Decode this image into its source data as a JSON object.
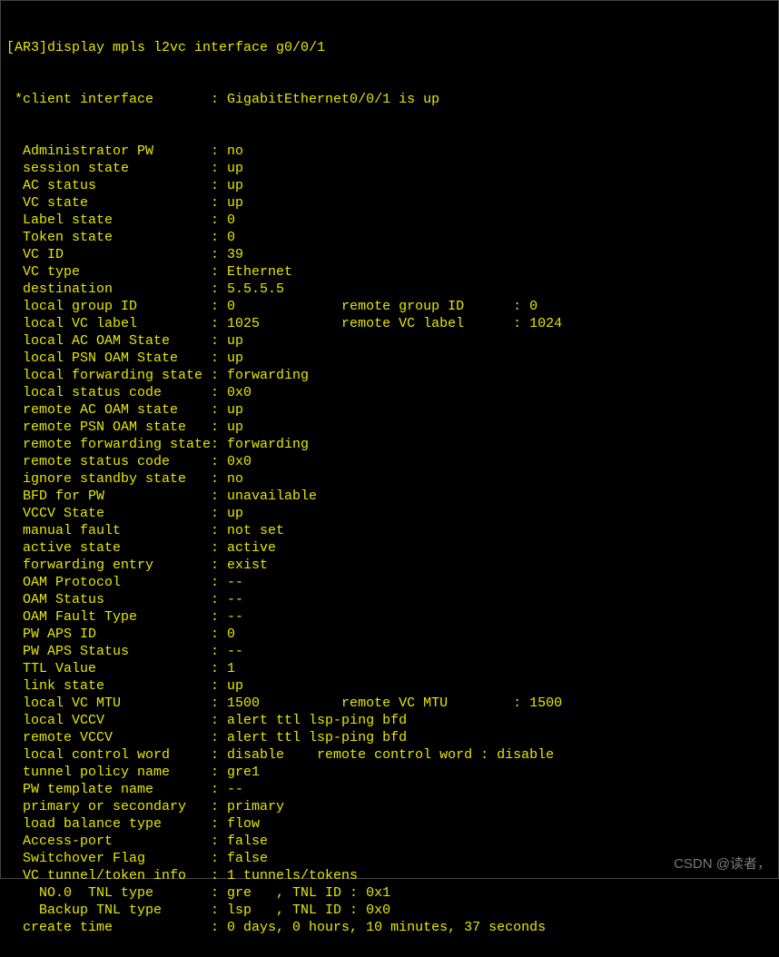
{
  "prompt_prefix": "[AR3]",
  "command": "display mpls l2vc interface g0/0/1",
  "client_interface_line": " *client interface       : GigabitEthernet0/0/1 is up",
  "rows": [
    {
      "label": "  Administrator PW",
      "value": "no"
    },
    {
      "label": "  session state",
      "value": "up"
    },
    {
      "label": "  AC status",
      "value": "up"
    },
    {
      "label": "  VC state",
      "value": "up"
    },
    {
      "label": "  Label state",
      "value": "0"
    },
    {
      "label": "  Token state",
      "value": "0"
    },
    {
      "label": "  VC ID",
      "value": "39"
    },
    {
      "label": "  VC type",
      "value": "Ethernet"
    },
    {
      "label": "  destination",
      "value": "5.5.5.5"
    },
    {
      "label": "  local group ID",
      "value": "0",
      "label2": "remote group ID",
      "value2": "0"
    },
    {
      "label": "  local VC label",
      "value": "1025",
      "label2": "remote VC label",
      "value2": "1024"
    },
    {
      "label": "  local AC OAM State",
      "value": "up"
    },
    {
      "label": "  local PSN OAM State",
      "value": "up"
    },
    {
      "label": "  local forwarding state",
      "value": "forwarding"
    },
    {
      "label": "  local status code",
      "value": "0x0"
    },
    {
      "label": "  remote AC OAM state",
      "value": "up"
    },
    {
      "label": "  remote PSN OAM state",
      "value": "up"
    },
    {
      "label": "  remote forwarding state",
      "value": "forwarding"
    },
    {
      "label": "  remote status code",
      "value": "0x0"
    },
    {
      "label": "  ignore standby state",
      "value": "no"
    },
    {
      "label": "  BFD for PW",
      "value": "unavailable"
    },
    {
      "label": "  VCCV State",
      "value": "up"
    },
    {
      "label": "  manual fault",
      "value": "not set"
    },
    {
      "label": "  active state",
      "value": "active"
    },
    {
      "label": "  forwarding entry",
      "value": "exist"
    },
    {
      "label": "  OAM Protocol",
      "value": "--"
    },
    {
      "label": "  OAM Status",
      "value": "--"
    },
    {
      "label": "  OAM Fault Type",
      "value": "--"
    },
    {
      "label": "  PW APS ID",
      "value": "0"
    },
    {
      "label": "  PW APS Status",
      "value": "--"
    },
    {
      "label": "  TTL Value",
      "value": "1"
    },
    {
      "label": "  link state",
      "value": "up"
    },
    {
      "label": "  local VC MTU",
      "value": "1500",
      "label2": "remote VC MTU",
      "value2": "1500"
    },
    {
      "label": "  local VCCV",
      "value": "alert ttl lsp-ping bfd"
    },
    {
      "label": "  remote VCCV",
      "value": "alert ttl lsp-ping bfd"
    },
    {
      "label": "  local control word",
      "value": "disable",
      "label2": "remote control word",
      "value2": "disable",
      "tight": true
    },
    {
      "label": "  tunnel policy name",
      "value": "gre1"
    },
    {
      "label": "  PW template name",
      "value": "--"
    },
    {
      "label": "  primary or secondary",
      "value": "primary"
    },
    {
      "label": "  load balance type",
      "value": "flow"
    },
    {
      "label": "  Access-port",
      "value": "false"
    },
    {
      "label": "  Switchover Flag",
      "value": "false"
    },
    {
      "label": "  VC tunnel/token info",
      "value": "1 tunnels/tokens"
    },
    {
      "label": "    NO.0  TNL type",
      "value": "gre   , TNL ID : 0x1"
    },
    {
      "label": "    Backup TNL type",
      "value": "lsp   , TNL ID : 0x0"
    },
    {
      "label": "  create time",
      "value": "0 days, 0 hours, 10 minutes, 37 seconds"
    }
  ],
  "watermark": "CSDN @读者，"
}
